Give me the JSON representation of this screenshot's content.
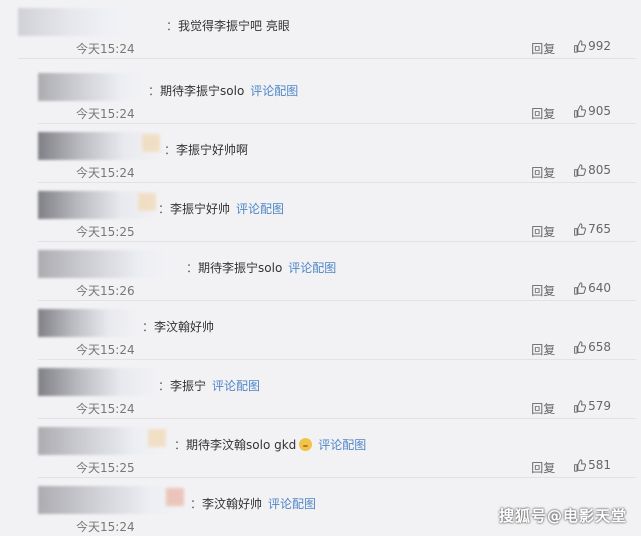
{
  "comments": [
    {
      "text": "我觉得李振宁吧 亮眼",
      "link": "",
      "time": "今天15:24",
      "reply": "回复",
      "likes": "992"
    },
    {
      "text": "期待李振宁solo",
      "link": "评论配图",
      "time": "今天15:24",
      "reply": "回复",
      "likes": "905"
    },
    {
      "text": "李振宁好帅啊",
      "link": "",
      "time": "今天15:24",
      "reply": "回复",
      "likes": "805"
    },
    {
      "text": "李振宁好帅",
      "link": "评论配图",
      "time": "今天15:25",
      "reply": "回复",
      "likes": "765"
    },
    {
      "text": "期待李振宁solo",
      "link": "评论配图",
      "time": "今天15:26",
      "reply": "回复",
      "likes": "640"
    },
    {
      "text": "李汶翰好帅",
      "link": "",
      "time": "今天15:24",
      "reply": "回复",
      "likes": "658"
    },
    {
      "text": "李振宁",
      "link": "评论配图",
      "time": "今天15:24",
      "reply": "回复",
      "likes": "579"
    },
    {
      "text": "期待李汶翰solo gkd",
      "link": "评论配图",
      "time": "今天15:25",
      "reply": "回复",
      "likes": "581"
    },
    {
      "text": "李汶翰好帅",
      "link": "评论配图",
      "time": "今天15:24",
      "reply": "回复",
      "likes": ""
    }
  ],
  "separator": "：",
  "watermark": "搜狐号@电影天堂",
  "icons": {
    "like": "thumbs-up-icon",
    "emoji": "smiley-emoji-icon"
  },
  "colors": {
    "background": "#f2f2f5",
    "link": "#4e86c6",
    "text": "#333333",
    "muted": "#777777"
  }
}
